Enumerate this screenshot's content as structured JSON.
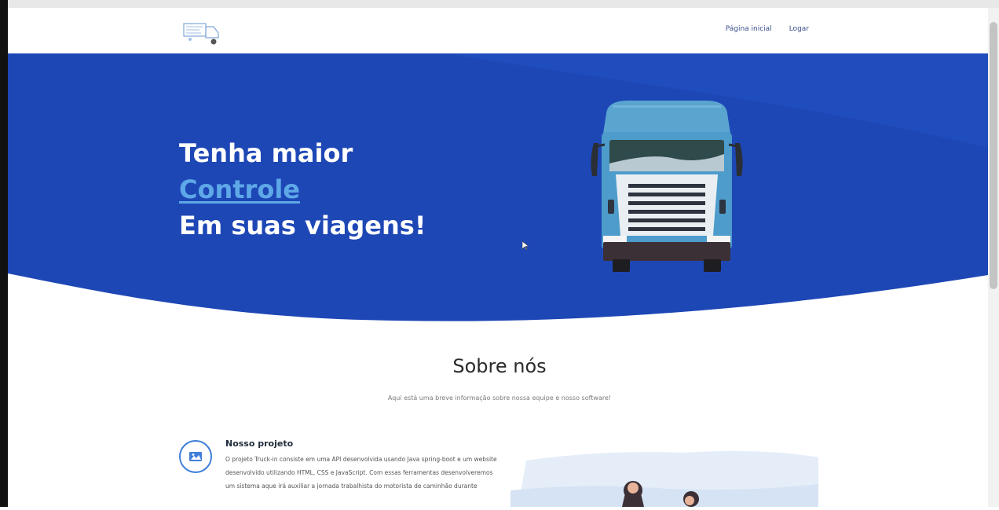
{
  "navbar": {
    "logo": "truck-logo-icon",
    "links": [
      {
        "label": "Página inicial"
      },
      {
        "label": "Logar"
      }
    ]
  },
  "hero": {
    "line1": "Tenha maior",
    "highlight": "Controle",
    "line3": "Em suas viagens!",
    "bg_color": "#1e47b6",
    "highlight_color": "#5ea8e8"
  },
  "about": {
    "title": "Sobre nós",
    "subtitle": "Aqui está uma breve informação sobre nossa equipe e nosso software!",
    "feature": {
      "icon": "image-icon",
      "title": "Nosso projeto",
      "text": "O projeto Truck-in consiste em uma API desenvolvida usando Java spring-boot e um website desenvolvido utilizando HTML, CSS e JavaScript. Com essas ferramentas desenvolveremos um sistema aque irá auxiliar a jornada trabalhista do motorista de caminhão durante"
    }
  }
}
